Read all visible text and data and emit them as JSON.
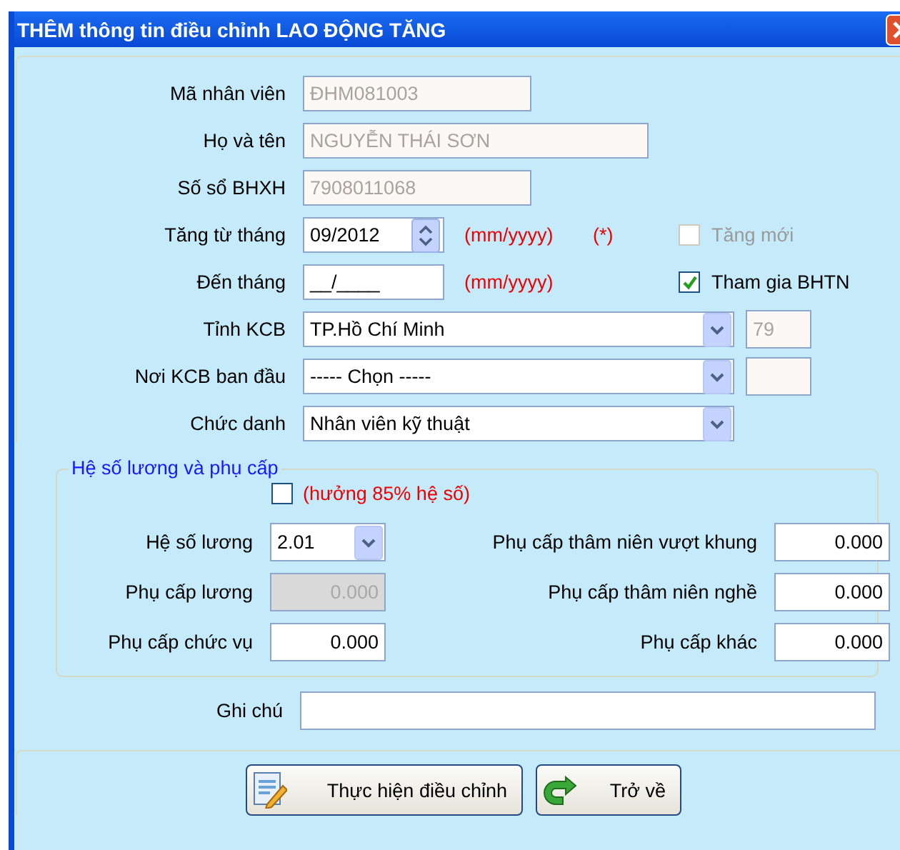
{
  "window": {
    "title": "THÊM thông tin điều chỉnh LAO ĐỘNG TĂNG"
  },
  "employee": [
    {
      "label": "Mã nhân viên",
      "value": "ĐHM081003"
    },
    {
      "label": "Họ và tên",
      "value": "NGUYỄN THÁI SƠN"
    },
    {
      "label": "Số sổ BHXH",
      "value": "7908011068"
    }
  ],
  "period": [
    {
      "label": "Tăng từ tháng",
      "value": "09/2012",
      "kind": "spinner",
      "hint": "(mm/yyyy)",
      "required": "(*)",
      "checkbox": {
        "label": "Tăng mới",
        "checked": false,
        "disabled": true
      }
    },
    {
      "label": "Đến tháng",
      "value": "__/____",
      "kind": "text",
      "hint": "(mm/yyyy)",
      "checkbox": {
        "label": "Tham gia BHTN",
        "checked": true,
        "disabled": false
      }
    }
  ],
  "combos": [
    {
      "label": "Tỉnh KCB",
      "value": "TP.Hồ Chí Minh",
      "kind": "with_code",
      "code": "79"
    },
    {
      "label": "Nơi KCB ban đầu",
      "value": "----- Chọn -----",
      "kind": "with_code"
    },
    {
      "label": "Chức danh",
      "value": "Nhân viên kỹ thuật",
      "kind": "plain"
    }
  ],
  "salary_group": {
    "legend": "Hệ số lương và phụ cấp",
    "checkbox": {
      "label": "(hưởng 85% hệ số)",
      "checked": false
    },
    "left": [
      {
        "label": "Hệ số lương",
        "value": "2.01",
        "kind": "combo"
      },
      {
        "label": "Phụ cấp lương",
        "value": "0.000",
        "kind": "disabled"
      },
      {
        "label": "Phụ cấp chức vụ",
        "value": "0.000",
        "kind": "text"
      }
    ],
    "right": [
      {
        "label": "Phụ cấp thâm niên vượt khung",
        "value": "0.000"
      },
      {
        "label": "Phụ cấp thâm niên nghề",
        "value": "0.000"
      },
      {
        "label": "Phụ cấp khác",
        "value": "0.000"
      }
    ]
  },
  "note": {
    "label": "Ghi chú"
  },
  "buttons": [
    {
      "label": "Thực hiện điều chỉnh",
      "kind": "edit"
    },
    {
      "label": "Trở về",
      "kind": "back"
    }
  ]
}
